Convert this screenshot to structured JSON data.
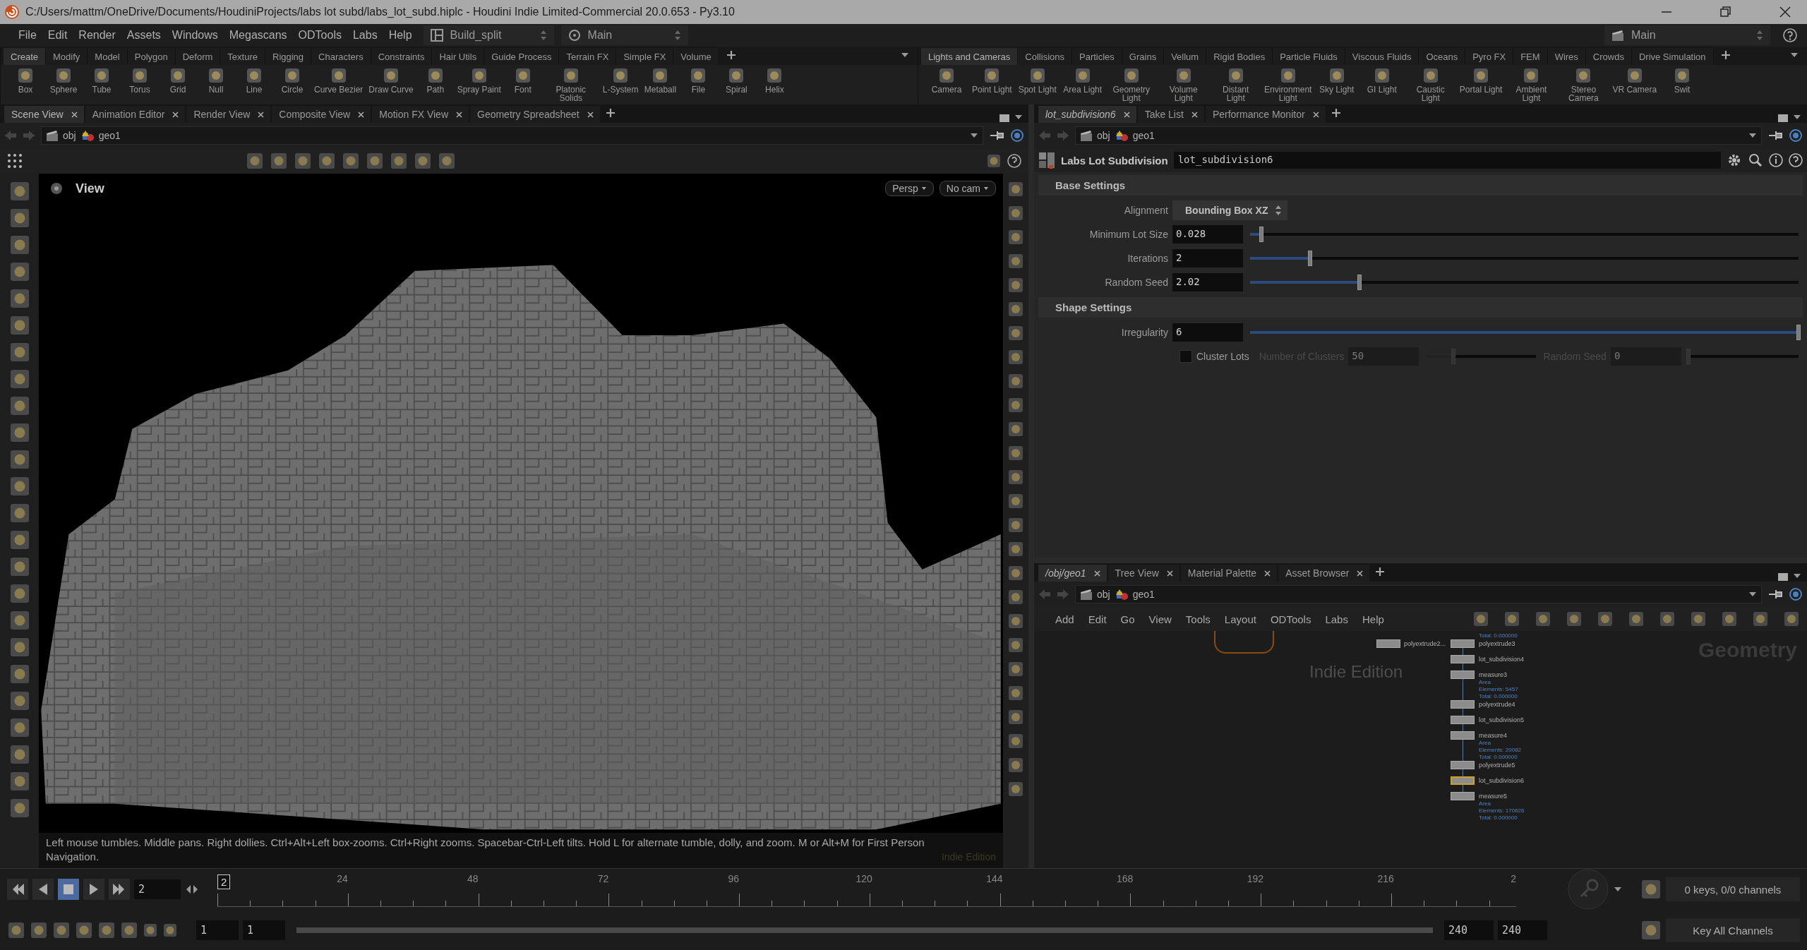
{
  "window": {
    "title": "C:/Users/mattm/OneDrive/Documents/HoudiniProjects/labs lot subd/labs_lot_subd.hiplc - Houdini Indie Limited-Commercial 20.0.653 - Py3.10"
  },
  "menu": [
    "File",
    "Edit",
    "Render",
    "Assets",
    "Windows",
    "Megascans",
    "ODTools",
    "Labs",
    "Help"
  ],
  "desktops": [
    {
      "label": "Build_split"
    },
    {
      "label": "Main"
    }
  ],
  "right_desktop": {
    "label": "Main"
  },
  "shelf_left": {
    "tabs": [
      {
        "label": "Create",
        "selected": true
      },
      {
        "label": "Modify",
        "selected": false
      },
      {
        "label": "Model",
        "selected": false
      },
      {
        "label": "Polygon",
        "selected": false
      },
      {
        "label": "Deform",
        "selected": false
      },
      {
        "label": "Texture",
        "selected": false
      },
      {
        "label": "Rigging",
        "selected": false
      },
      {
        "label": "Characters",
        "selected": false
      },
      {
        "label": "Constraints",
        "selected": false
      },
      {
        "label": "Hair Utils",
        "selected": false
      },
      {
        "label": "Guide Process",
        "selected": false
      },
      {
        "label": "Terrain FX",
        "selected": false
      },
      {
        "label": "Simple FX",
        "selected": false
      },
      {
        "label": "Volume",
        "selected": false
      }
    ],
    "tools": [
      "Box",
      "Sphere",
      "Tube",
      "Torus",
      "Grid",
      "Null",
      "Line",
      "Circle",
      "Curve Bezier",
      "Draw Curve",
      "Path",
      "Spray Paint",
      "Font",
      "Platonic Solids",
      "L-System",
      "Metaball",
      "File",
      "Spiral",
      "Helix"
    ]
  },
  "shelf_right": {
    "tabs": [
      {
        "label": "Lights and Cameras",
        "selected": true
      },
      {
        "label": "Collisions",
        "selected": false
      },
      {
        "label": "Particles",
        "selected": false
      },
      {
        "label": "Grains",
        "selected": false
      },
      {
        "label": "Vellum",
        "selected": false
      },
      {
        "label": "Rigid Bodies",
        "selected": false
      },
      {
        "label": "Particle Fluids",
        "selected": false
      },
      {
        "label": "Viscous Fluids",
        "selected": false
      },
      {
        "label": "Oceans",
        "selected": false
      },
      {
        "label": "Pyro FX",
        "selected": false
      },
      {
        "label": "FEM",
        "selected": false
      },
      {
        "label": "Wires",
        "selected": false
      },
      {
        "label": "Crowds",
        "selected": false
      },
      {
        "label": "Drive Simulation",
        "selected": false
      }
    ],
    "tools": [
      "Camera",
      "Point Light",
      "Spot Light",
      "Area Light",
      "Geometry Light",
      "Volume Light",
      "Distant Light",
      "Environment Light",
      "Sky Light",
      "GI Light",
      "Caustic Light",
      "Portal Light",
      "Ambient Light",
      "Stereo Camera",
      "VR Camera",
      "Swit"
    ]
  },
  "scene_pane": {
    "tabs": [
      {
        "label": "Scene View",
        "selected": true
      },
      {
        "label": "Animation Editor",
        "selected": false
      },
      {
        "label": "Render View",
        "selected": false
      },
      {
        "label": "Composite View",
        "selected": false
      },
      {
        "label": "Motion FX View",
        "selected": false
      },
      {
        "label": "Geometry Spreadsheet",
        "selected": false
      }
    ],
    "path": [
      "obj",
      "geo1"
    ],
    "view_label": "View",
    "camera_menus": [
      "Persp",
      "No cam"
    ],
    "hint": "Left mouse tumbles. Middle pans. Right dollies. Ctrl+Alt+Left box-zooms. Ctrl+Right zooms. Spacebar-Ctrl-Left tilts. Hold L for alternate tumble, dolly, and zoom. M or Alt+M for First Person Navigation.",
    "edition": "Indie Edition"
  },
  "params_pane": {
    "tabs": [
      {
        "label": "lot_subdivision6",
        "selected": true
      },
      {
        "label": "Take List",
        "selected": false
      },
      {
        "label": "Performance Monitor",
        "selected": false
      }
    ],
    "path": [
      "obj",
      "geo1"
    ],
    "node_type": "Labs Lot Subdivision",
    "node_name": "lot_subdivision6",
    "sections": [
      {
        "title": "Base Settings",
        "parms": [
          {
            "kind": "menu",
            "label": "Alignment",
            "value": "Bounding Box XZ"
          },
          {
            "kind": "slider",
            "label": "Minimum Lot Size",
            "value": "0.028",
            "level": 0.02
          },
          {
            "kind": "slider",
            "label": "Iterations",
            "value": "2",
            "level": 0.11
          },
          {
            "kind": "slider",
            "label": "Random Seed",
            "value": "2.02",
            "level": 0.2
          }
        ]
      },
      {
        "title": "Shape Settings",
        "parms": [
          {
            "kind": "slider",
            "label": "Irregularity",
            "value": "6",
            "level": 1
          },
          {
            "kind": "toggle",
            "label": "Cluster Lots",
            "checked": false,
            "extras": [
              {
                "label": "Number of Clusters",
                "value": "50",
                "level": 0.25,
                "disabled": true
              },
              {
                "label": "Random Seed",
                "value": "0",
                "level": 0,
                "disabled": true
              }
            ]
          }
        ]
      }
    ]
  },
  "network_pane": {
    "tabs": [
      {
        "label": "/obj/geo1",
        "selected": true
      },
      {
        "label": "Tree View",
        "selected": false
      },
      {
        "label": "Material Palette",
        "selected": false
      },
      {
        "label": "Asset Browser",
        "selected": false
      }
    ],
    "path": [
      "obj",
      "geo1"
    ],
    "menu": [
      "Add",
      "Edit",
      "Go",
      "View",
      "Tools",
      "Layout",
      "ODTools",
      "Labs",
      "Help"
    ],
    "context": "Geometry",
    "edition": "Indie Edition",
    "top_note": "Total: 0.000000",
    "side_node": "polyextrude2...",
    "nodes": [
      {
        "name": "polyextrude3",
        "selected": false
      },
      {
        "name": "lot_subdivision4",
        "selected": false
      },
      {
        "name": "measure3",
        "selected": false,
        "info": [
          "Area",
          "Elements: 5457",
          "Total: 0.000000"
        ]
      },
      {
        "name": "polyextrude4",
        "selected": false
      },
      {
        "name": "lot_subdivision5",
        "selected": false
      },
      {
        "name": "measure4",
        "selected": false,
        "info": [
          "Area",
          "Elements: 20082",
          "Total: 0.000000"
        ]
      },
      {
        "name": "polyextrude5",
        "selected": false
      },
      {
        "name": "lot_subdivision6",
        "selected": true
      },
      {
        "name": "measure5",
        "selected": false,
        "info": [
          "Area",
          "Elements: 170626",
          "Total: 0.000000"
        ]
      }
    ]
  },
  "timeline": {
    "frame": "2",
    "marker": "2",
    "ticks": [
      "24",
      "48",
      "72",
      "96",
      "120",
      "144",
      "168",
      "192",
      "216",
      "2"
    ],
    "start": "1",
    "range_start": "1",
    "range_end": "240",
    "end": "240",
    "keys": "0 keys, 0/0 channels",
    "key_mode": "Key All Channels"
  }
}
